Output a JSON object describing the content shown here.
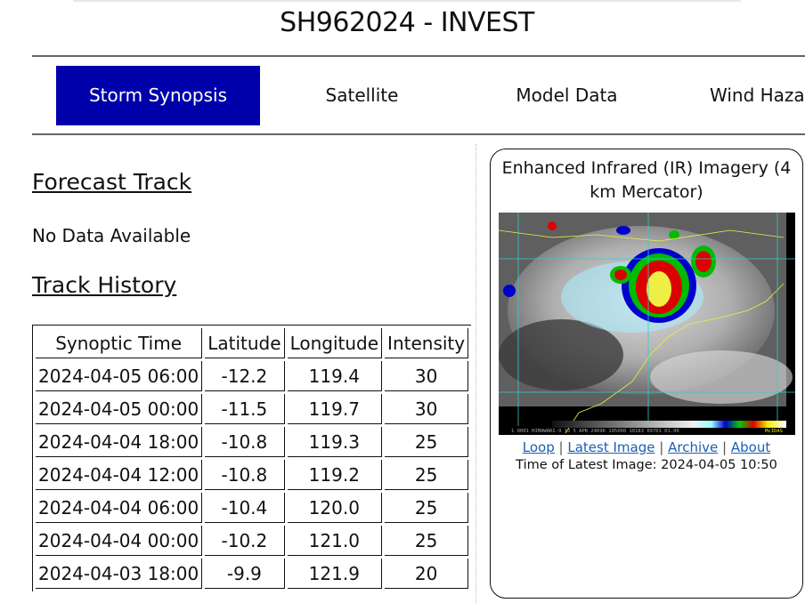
{
  "page": {
    "title": "SH962024 - INVEST"
  },
  "nav": {
    "tabs": [
      {
        "label": "Storm Synopsis",
        "active": true
      },
      {
        "label": "Satellite",
        "active": false
      },
      {
        "label": "Model Data",
        "active": false
      },
      {
        "label": "Wind Haza",
        "active": false
      }
    ],
    "active_color": "#0000aa"
  },
  "forecast": {
    "heading": "Forecast Track",
    "status": "No Data Available"
  },
  "history": {
    "heading": "Track History",
    "columns": [
      "Synoptic Time",
      "Latitude",
      "Longitude",
      "Intensity"
    ],
    "rows": [
      [
        "2024-04-05 06:00",
        "-12.2",
        "119.4",
        "30"
      ],
      [
        "2024-04-05 00:00",
        "-11.5",
        "119.7",
        "30"
      ],
      [
        "2024-04-04 18:00",
        "-10.8",
        "119.3",
        "25"
      ],
      [
        "2024-04-04 12:00",
        "-10.8",
        "119.2",
        "25"
      ],
      [
        "2024-04-04 06:00",
        "-10.4",
        "120.0",
        "25"
      ],
      [
        "2024-04-04 00:00",
        "-10.2",
        "121.0",
        "25"
      ],
      [
        "2024-04-03 18:00",
        "-9.9",
        "121.9",
        "20"
      ]
    ]
  },
  "satellite": {
    "title": "Enhanced Infrared (IR) Imagery (4 km Mercator)",
    "caption_strip": "1 0001 HIMAWARI-9 13  5 APR 24096 105000 10183 09701 01.00",
    "caption_brand": "McIDAS",
    "links": [
      "Loop",
      "Latest Image",
      "Archive",
      "About"
    ],
    "separator": "|",
    "latest_label": "Time of Latest Image: 2024-04-05 10:50"
  }
}
